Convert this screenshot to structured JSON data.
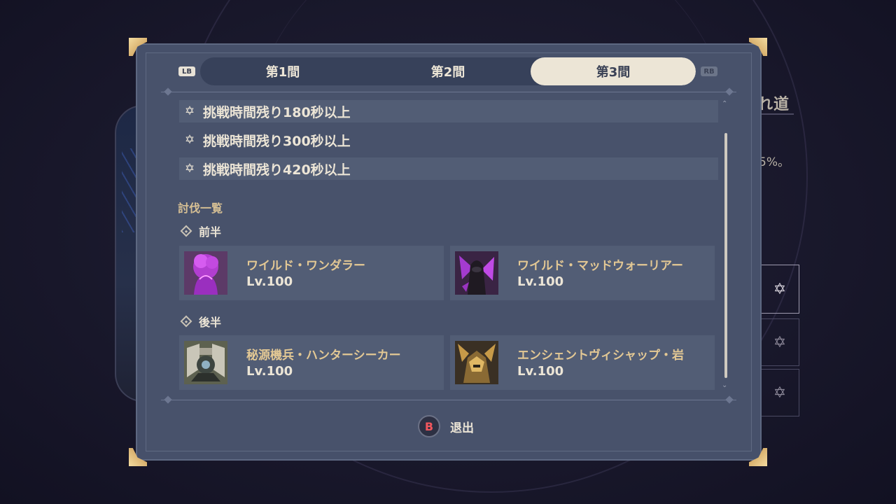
{
  "background": {
    "right_title": "れ道",
    "right_percent": "5%。",
    "right_star_icon": "star-icon"
  },
  "tabs": {
    "lb_label": "LB",
    "rb_label": "RB",
    "items": [
      {
        "label": "第1間",
        "active": false
      },
      {
        "label": "第2間",
        "active": false
      },
      {
        "label": "第3間",
        "active": true
      }
    ]
  },
  "conditions": [
    {
      "icon": "star-icon",
      "text": "挑戦時間残り180秒以上"
    },
    {
      "icon": "star-icon",
      "text": "挑戦時間残り300秒以上"
    },
    {
      "icon": "star-icon",
      "text": "挑戦時間残り420秒以上"
    }
  ],
  "enemy_list": {
    "title": "討伐一覧",
    "first_half": {
      "label": "前半",
      "enemies": [
        {
          "name": "ワイルド・ワンダラー",
          "level": "Lv.100",
          "portrait": "magenta-wanderer-portrait"
        },
        {
          "name": "ワイルド・マッドウォーリアー",
          "level": "Lv.100",
          "portrait": "dark-warrior-portrait"
        }
      ]
    },
    "second_half": {
      "label": "後半",
      "enemies": [
        {
          "name": "秘源機兵・ハンターシーカー",
          "level": "Lv.100",
          "portrait": "construct-portrait"
        },
        {
          "name": "エンシェントヴィシャップ・岩",
          "level": "Lv.100",
          "portrait": "vishap-portrait"
        }
      ]
    }
  },
  "footer": {
    "button_key": "B",
    "exit_label": "退出"
  },
  "colors": {
    "panel": "#46506a",
    "row": "#525d75",
    "accent_gold": "#e3c894",
    "tab_active": "#ece5d6",
    "b_button": "#f0565d"
  }
}
